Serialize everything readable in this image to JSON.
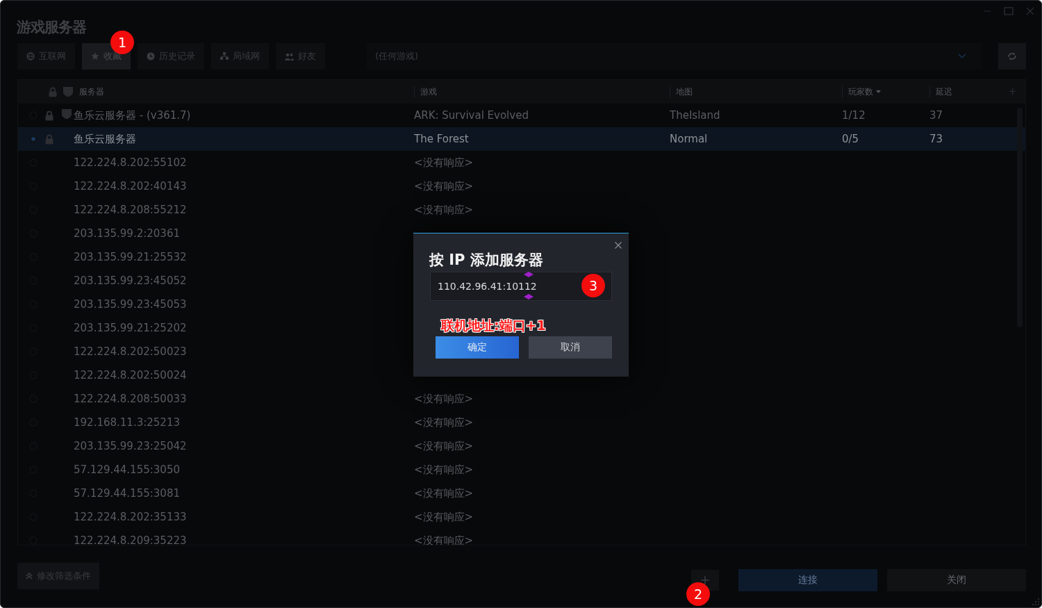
{
  "window": {
    "title": "游戏服务器"
  },
  "tabs": [
    {
      "label": "互联网",
      "selected": false
    },
    {
      "label": "收藏",
      "selected": true
    },
    {
      "label": "历史记录",
      "selected": false
    },
    {
      "label": "局域网",
      "selected": false
    },
    {
      "label": "好友",
      "selected": false
    }
  ],
  "game_filter": {
    "value": "(任何游戏)"
  },
  "table": {
    "columns": [
      {
        "label": "服务器",
        "sorted": false
      },
      {
        "label": "游戏",
        "sorted": false
      },
      {
        "label": "地图",
        "sorted": false
      },
      {
        "label": "玩家数",
        "sorted": true
      },
      {
        "label": "延迟",
        "sorted": false
      }
    ],
    "rows": [
      {
        "server": "鱼乐云服务器 - (v361.7)",
        "game": "ARK: Survival Evolved",
        "map": "TheIsland",
        "players": "1/12",
        "ping": "37",
        "selected": false,
        "locked": true,
        "vac": true
      },
      {
        "server": "鱼乐云服务器",
        "game": "The Forest",
        "map": "Normal",
        "players": "0/5",
        "ping": "73",
        "selected": true,
        "locked": true,
        "vac": false
      },
      {
        "server": "122.224.8.202:55102",
        "game": "<没有响应>",
        "selected": false,
        "locked": false,
        "vac": false
      },
      {
        "server": "122.224.8.202:40143",
        "game": "<没有响应>",
        "selected": false,
        "locked": false,
        "vac": false
      },
      {
        "server": "122.224.8.208:55212",
        "game": "<没有响应>",
        "selected": false,
        "locked": false,
        "vac": false
      },
      {
        "server": "203.135.99.2:20361",
        "selected": false,
        "locked": false,
        "vac": false
      },
      {
        "server": "203.135.99.21:25532",
        "selected": false,
        "locked": false,
        "vac": false
      },
      {
        "server": "203.135.99.23:45052",
        "selected": false,
        "locked": false,
        "vac": false
      },
      {
        "server": "203.135.99.23:45053",
        "selected": false,
        "locked": false,
        "vac": false
      },
      {
        "server": "203.135.99.21:25202",
        "selected": false,
        "locked": false,
        "vac": false
      },
      {
        "server": "122.224.8.202:50023",
        "selected": false,
        "locked": false,
        "vac": false
      },
      {
        "server": "122.224.8.202:50024",
        "selected": false,
        "locked": false,
        "vac": false
      },
      {
        "server": "122.224.8.208:50033",
        "game": "<没有响应>",
        "selected": false,
        "locked": false,
        "vac": false
      },
      {
        "server": "192.168.11.3:25213",
        "game": "<没有响应>",
        "selected": false,
        "locked": false,
        "vac": false
      },
      {
        "server": "203.135.99.23:25042",
        "game": "<没有响应>",
        "selected": false,
        "locked": false,
        "vac": false
      },
      {
        "server": "57.129.44.155:3050",
        "game": "<没有响应>",
        "selected": false,
        "locked": false,
        "vac": false
      },
      {
        "server": "57.129.44.155:3081",
        "game": "<没有响应>",
        "selected": false,
        "locked": false,
        "vac": false
      },
      {
        "server": "122.224.8.202:35133",
        "game": "<没有响应>",
        "selected": false,
        "locked": false,
        "vac": false
      },
      {
        "server": "122.224.8.209:35223",
        "game": "<没有响应>",
        "selected": false,
        "locked": false,
        "vac": false
      }
    ]
  },
  "footer": {
    "filter_button": "修改筛选条件",
    "connect_button": "连接",
    "close_button": "关闭"
  },
  "dialog": {
    "title": "按 IP 添加服务器",
    "input_value": "110.42.96.41:10112",
    "note": "联机地址:端口+1",
    "buttons": [
      {
        "label": "确定",
        "kind": "primary"
      },
      {
        "label": "取消",
        "kind": "secondary"
      }
    ]
  },
  "markers": [
    "1",
    "2",
    "3"
  ]
}
